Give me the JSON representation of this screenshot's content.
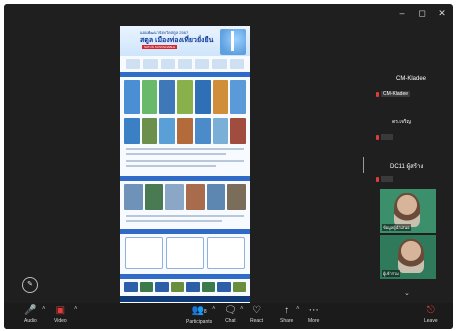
{
  "window": {
    "controls": [
      "–",
      "◻",
      "✕"
    ]
  },
  "share": {
    "poster": {
      "header_small": "แผนพัฒนาจังหวัดสตูล 2567",
      "title": "สตูล เมืองท่องเที่ยวยั่งยืน",
      "subtitle": "SATUN SUSTAINABLE"
    }
  },
  "participants": {
    "title": "CM-Kladee",
    "items": [
      {
        "name": "CM-Kladee"
      },
      {
        "name": "ดร.เจริญ"
      },
      {
        "name": "DC11 ผู้สร้าง"
      }
    ]
  },
  "tiles": [
    {
      "label": "ข้อมูลผู้นำเสนอ"
    },
    {
      "label": "ผู้เข้าร่วม"
    }
  ],
  "toolbar": {
    "audio": "Audio",
    "video": "Video",
    "participants": "Participants",
    "participants_count": "8",
    "chat": "Chat",
    "react": "React",
    "share": "Share",
    "more": "More",
    "leave": "Leave"
  },
  "colors": {
    "accent": "#e03c3c",
    "bg": "#1f1f1f",
    "tile": "#3b8f6a"
  }
}
